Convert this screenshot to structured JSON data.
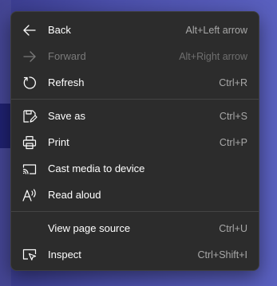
{
  "menu": {
    "items": [
      {
        "label": "Back",
        "shortcut": "Alt+Left arrow",
        "icon": "arrow-left-icon",
        "disabled": false
      },
      {
        "label": "Forward",
        "shortcut": "Alt+Right arrow",
        "icon": "arrow-right-icon",
        "disabled": true
      },
      {
        "label": "Refresh",
        "shortcut": "Ctrl+R",
        "icon": "refresh-icon",
        "disabled": false
      },
      {
        "label": "Save as",
        "shortcut": "Ctrl+S",
        "icon": "save-icon",
        "disabled": false
      },
      {
        "label": "Print",
        "shortcut": "Ctrl+P",
        "icon": "print-icon",
        "disabled": false
      },
      {
        "label": "Cast media to device",
        "shortcut": "",
        "icon": "cast-icon",
        "disabled": false
      },
      {
        "label": "Read aloud",
        "shortcut": "",
        "icon": "read-aloud-icon",
        "disabled": false
      },
      {
        "label": "View page source",
        "shortcut": "Ctrl+U",
        "icon": "",
        "disabled": false
      },
      {
        "label": "Inspect",
        "shortcut": "Ctrl+Shift+I",
        "icon": "inspect-icon",
        "disabled": false
      }
    ]
  },
  "colors": {
    "menu_background": "#2c2c2c",
    "text": "#ffffff",
    "disabled_text": "#7a7a7a",
    "shortcut_text": "#a8a8a8"
  }
}
